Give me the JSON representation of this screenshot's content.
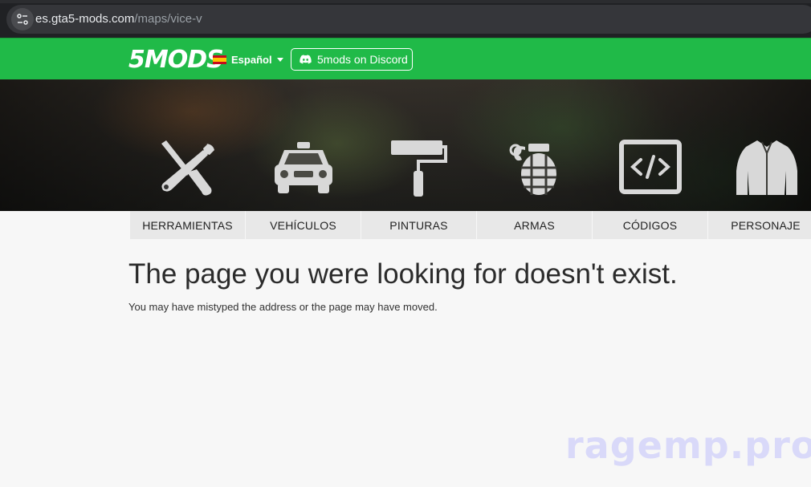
{
  "browser": {
    "url_host": "es.gta5-mods.com",
    "url_path": "/maps/vice-v"
  },
  "header": {
    "logo_text": "5MODS",
    "language_label": "Español",
    "discord_label": "5mods on Discord",
    "accent_color": "#20ba48"
  },
  "categories": [
    {
      "label": "HERRAMIENTAS",
      "icon": "tools-icon"
    },
    {
      "label": "VEHÍCULOS",
      "icon": "car-icon"
    },
    {
      "label": "PINTURAS",
      "icon": "paint-roller-icon"
    },
    {
      "label": "ARMAS",
      "icon": "grenade-icon"
    },
    {
      "label": "CÓDIGOS",
      "icon": "code-icon"
    },
    {
      "label": "PERSONAJE",
      "icon": "jacket-icon"
    }
  ],
  "main": {
    "error_title": "The page you were looking for doesn't exist.",
    "error_subtitle": "You may have mistyped the address or the page may have moved."
  },
  "watermark": "ragemp.pro"
}
